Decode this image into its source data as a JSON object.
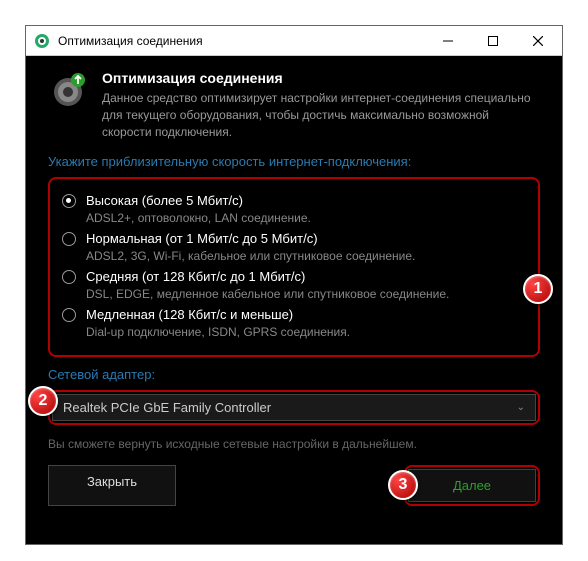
{
  "titlebar": {
    "title": "Оптимизация соединения"
  },
  "header": {
    "title": "Оптимизация соединения",
    "desc": "Данное средство оптимизирует настройки интернет-соединения специально для текущего оборудования, чтобы достичь максимально возможной скорости подключения."
  },
  "speed": {
    "label": "Укажите приблизительную скорость интернет-подключения:",
    "options": [
      {
        "label": "Высокая (более 5 Мбит/с)",
        "sub": "ADSL2+, оптоволокно, LAN соединение.",
        "selected": true
      },
      {
        "label": "Нормальная (от 1 Мбит/с до 5 Мбит/с)",
        "sub": "ADSL2, 3G, Wi-Fi, кабельное или спутниковое соединение.",
        "selected": false
      },
      {
        "label": "Средняя (от 128 Кбит/с до 1 Мбит/с)",
        "sub": "DSL, EDGE, медленное кабельное или спутниковое соединение.",
        "selected": false
      },
      {
        "label": "Медленная (128 Кбит/с и меньше)",
        "sub": "Dial-up подключение, ISDN, GPRS соединения.",
        "selected": false
      }
    ]
  },
  "adapter": {
    "label": "Сетевой адаптер:",
    "value": "Realtek PCIe GbE Family Controller"
  },
  "hint": "Вы сможете вернуть исходные сетевые настройки в дальнейшем.",
  "buttons": {
    "close": "Закрыть",
    "next": "Далее"
  },
  "callouts": {
    "c1": "1",
    "c2": "2",
    "c3": "3"
  }
}
